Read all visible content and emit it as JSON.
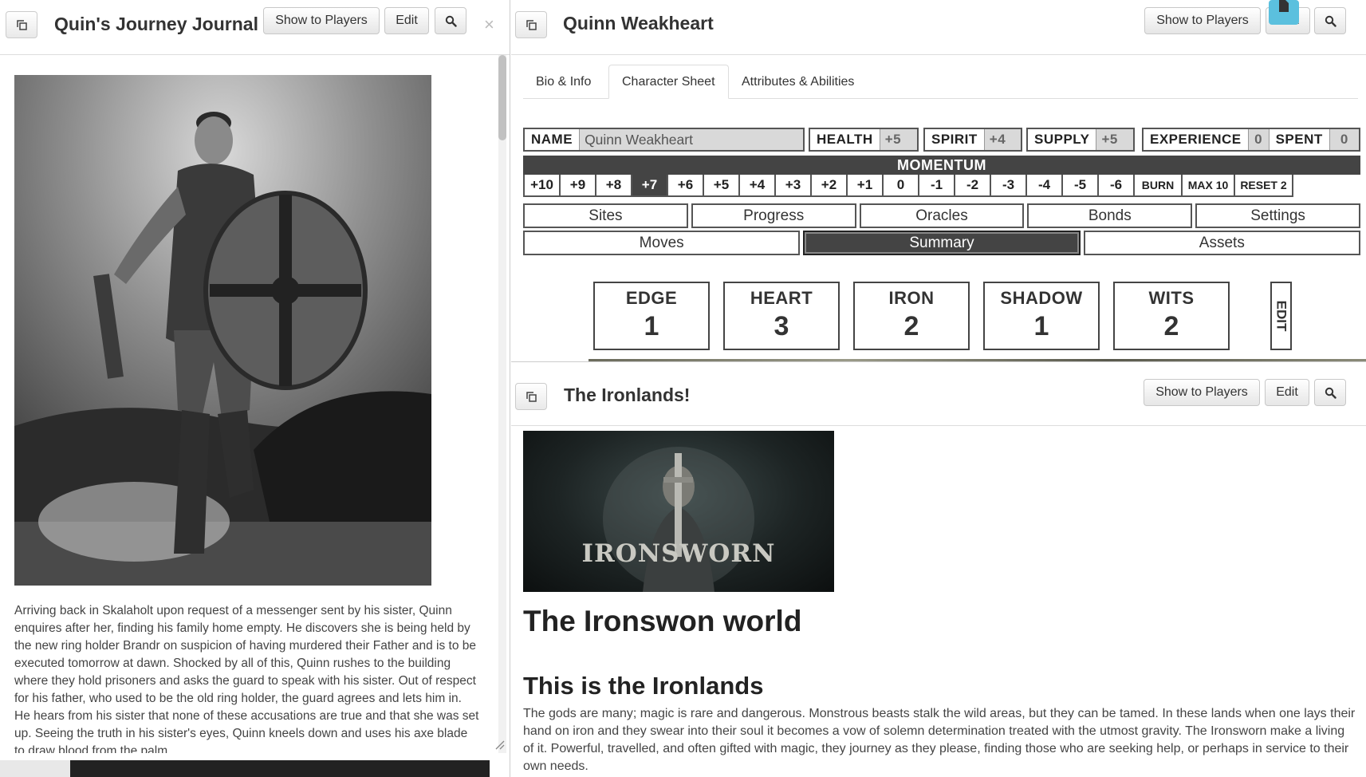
{
  "journal": {
    "title": "Quin's Journey Journal",
    "show_to_players": "Show to Players",
    "edit": "Edit",
    "close": "×",
    "story": "Arriving back in Skalaholt upon request of a messenger sent by his sister, Quinn enquires after her, finding his family home empty. He discovers she is being held by the new ring holder Brandr on suspicion of having murdered their Father and is to be executed tomorrow at dawn. Shocked by all of this, Quinn rushes to the building where they hold prisoners and asks the guard to speak with his sister. Out of respect for his father, who used to be the old ring holder, the guard agrees and lets him in. He hears from his sister that none of these accusations are true and that she was set up. Seeing the truth in his sister's eyes, Quinn kneels down and uses his axe blade to draw blood from the palm"
  },
  "character": {
    "title": "Quinn Weakheart",
    "show_to_players": "Show to Players",
    "edit": "Edit",
    "tabs": [
      {
        "label": "Bio & Info"
      },
      {
        "label": "Character Sheet"
      },
      {
        "label": "Attributes & Abilities"
      }
    ],
    "stats": {
      "name_label": "NAME",
      "name_value": "Quinn Weakheart",
      "health_label": "HEALTH",
      "health_value": "+5",
      "spirit_label": "SPIRIT",
      "spirit_value": "+4",
      "supply_label": "SUPPLY",
      "supply_value": "+5",
      "experience_label": "EXPERIENCE",
      "experience_value": "0",
      "spent_label": "SPENT",
      "spent_value": "0"
    },
    "momentum": {
      "label": "MOMENTUM",
      "values": [
        "+10",
        "+9",
        "+8",
        "+7",
        "+6",
        "+5",
        "+4",
        "+3",
        "+2",
        "+1",
        "0",
        "-1",
        "-2",
        "-3",
        "-4",
        "-5",
        "-6"
      ],
      "selected": "+7",
      "burn": "BURN",
      "max": "MAX 10",
      "reset": "RESET 2"
    },
    "nav_row1": [
      "Sites",
      "Progress",
      "Oracles",
      "Bonds",
      "Settings"
    ],
    "nav_row2": [
      "Moves",
      "Summary",
      "Assets"
    ],
    "nav_selected": "Summary",
    "attributes": [
      {
        "name": "EDGE",
        "value": "1"
      },
      {
        "name": "HEART",
        "value": "3"
      },
      {
        "name": "IRON",
        "value": "2"
      },
      {
        "name": "SHADOW",
        "value": "1"
      },
      {
        "name": "WITS",
        "value": "2"
      }
    ],
    "attr_edit": "EDIT"
  },
  "ironlands": {
    "title": "The Ironlands!",
    "show_to_players": "Show to Players",
    "edit": "Edit",
    "banner_text": "IRONSWORN",
    "heading1": "The Ironswon world",
    "heading2": "This is the Ironlands",
    "paragraph": "The gods are many; magic is rare and dangerous. Monstrous beasts stalk the wild areas, but they can be tamed. In these lands when one lays their hand on iron and they swear into their soul it becomes a vow of solemn determination treated with the utmost gravity. The Ironsworn make a living of it. Powerful, travelled, and often gifted with magic, they journey as they please, finding those who are seeking help, or perhaps in service to their own needs."
  },
  "colors": {
    "dark_cell": "#444444",
    "stat_value_bg": "#d9d9d9",
    "drag_tab": "#5bc0de"
  }
}
